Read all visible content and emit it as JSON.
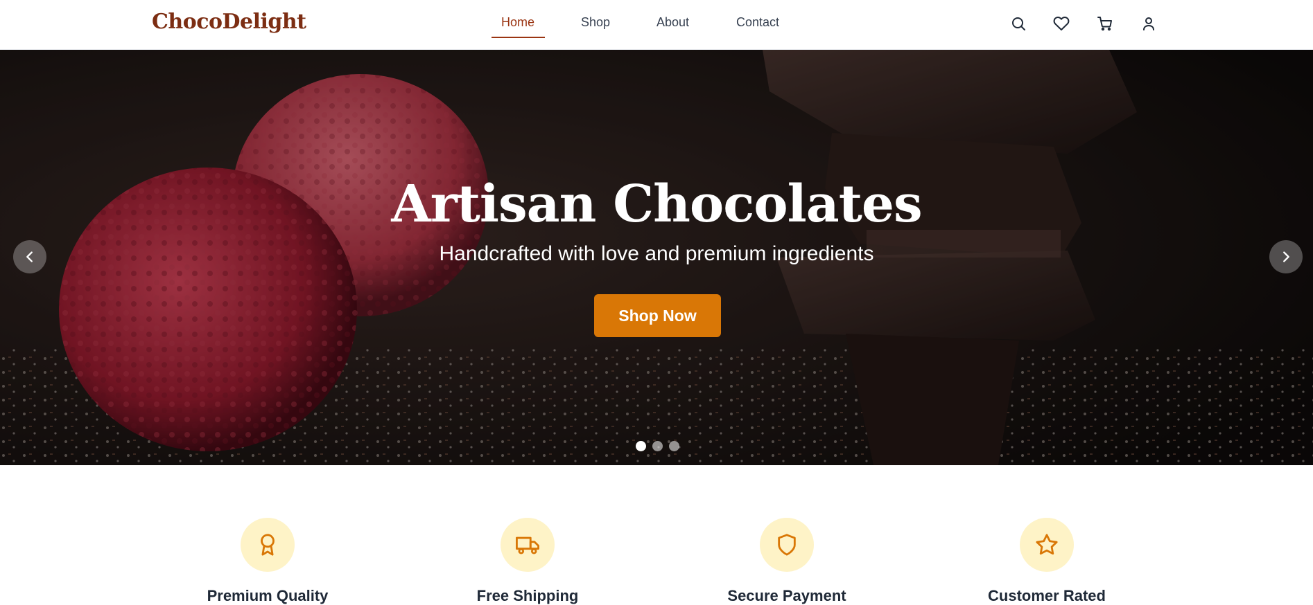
{
  "brand": {
    "name": "ChocoDelight"
  },
  "nav": {
    "items": [
      {
        "label": "Home",
        "active": true
      },
      {
        "label": "Shop",
        "active": false
      },
      {
        "label": "About",
        "active": false
      },
      {
        "label": "Contact",
        "active": false
      }
    ]
  },
  "header_icons": [
    "search-icon",
    "heart-icon",
    "cart-icon",
    "user-icon"
  ],
  "hero": {
    "title": "Artisan Chocolates",
    "subtitle": "Handcrafted with love and premium ingredients",
    "cta_label": "Shop Now",
    "slides_total": 3,
    "active_slide": 1
  },
  "features": [
    {
      "title": "Premium Quality",
      "icon": "award-icon"
    },
    {
      "title": "Free Shipping",
      "icon": "truck-icon"
    },
    {
      "title": "Secure Payment",
      "icon": "shield-icon"
    },
    {
      "title": "Customer Rated",
      "icon": "star-icon"
    }
  ],
  "colors": {
    "brand": "#7c2d12",
    "nav_active": "#9a3412",
    "accent": "#d97706",
    "feature_icon_bg": "#fef3c7"
  }
}
